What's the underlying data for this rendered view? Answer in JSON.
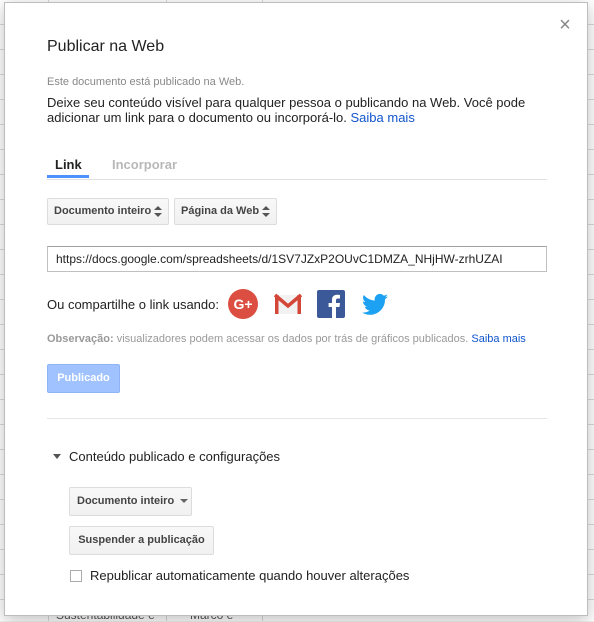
{
  "background": {
    "cells": [
      "Sustentabilidade e",
      "Marco e"
    ]
  },
  "dialog": {
    "title": "Publicar na Web",
    "close_label": "×",
    "status_text": "Este documento está publicado na Web.",
    "description": "Deixe seu conteúdo visível para qualquer pessoa o publicando na Web. Você pode adicionar um link para o documento ou incorporá-lo.",
    "learn_more": "Saiba mais"
  },
  "tabs": [
    {
      "label": "Link",
      "active": true
    },
    {
      "label": "Incorporar",
      "active": false
    }
  ],
  "selects": {
    "scope": "Documento inteiro",
    "format": "Página da Web"
  },
  "url": {
    "value": "https://docs.google.com/spreadsheets/d/1SV7JZxP2OUvC1DMZA_NHjHW-zrhUZAI"
  },
  "share": {
    "label": "Ou compartilhe o link usando:",
    "icons": [
      "google-plus-icon",
      "gmail-icon",
      "facebook-icon",
      "twitter-icon"
    ],
    "colors": {
      "google_plus": "#dc4e41",
      "gmail": "#d44638",
      "facebook": "#3b5998",
      "twitter": "#1da1f2"
    }
  },
  "note": {
    "label": "Observação:",
    "text": "visualizadores podem acessar os dados por trás de gráficos publicados.",
    "learn_more": "Saiba mais"
  },
  "published_button": "Publicado",
  "settings": {
    "toggle_label": "Conteúdo publicado e configurações",
    "scope_dropdown": "Documento inteiro",
    "stop_button": "Suspender a publicação",
    "republish_label": "Republicar automaticamente quando houver alterações",
    "republish_checked": false
  },
  "colors": {
    "accent": "#4d90fe",
    "link": "#1155cc",
    "published_button": "#a0c3ff"
  }
}
